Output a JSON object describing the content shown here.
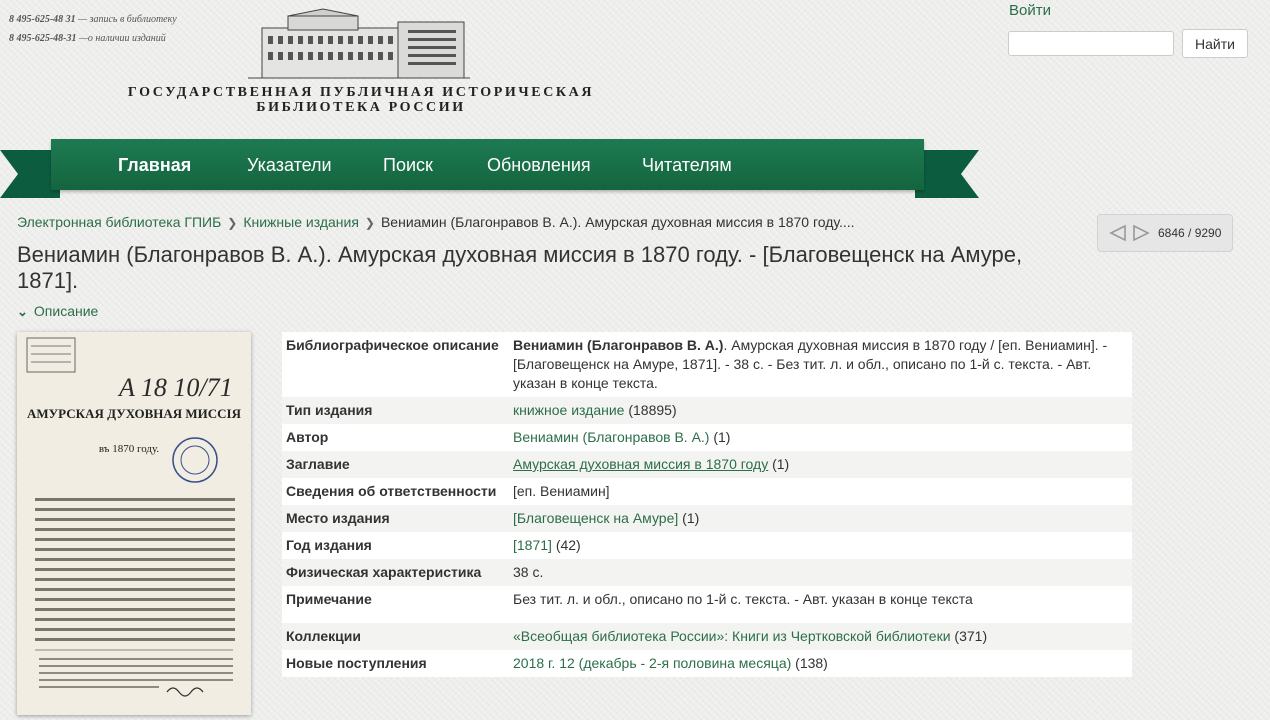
{
  "header": {
    "phones": [
      {
        "number": "8 495-625-48 31",
        "note": " — запись в библиотеку"
      },
      {
        "number": "8 495-625-48-31",
        "note": " —о наличии изданий"
      }
    ],
    "library_name": "ГОСУДАРСТВЕННАЯ ПУБЛИЧНАЯ ИСТОРИЧЕСКАЯ БИБЛИОТЕКА РОССИИ",
    "login": "Войти",
    "search_value": "",
    "search_button": "Найти"
  },
  "nav": [
    {
      "label": "Главная",
      "active": true
    },
    {
      "label": "Указатели"
    },
    {
      "label": "Поиск"
    },
    {
      "label": "Обновления"
    },
    {
      "label": "Читателям"
    }
  ],
  "breadcrumb": [
    {
      "label": "Электронная библиотека ГПИБ"
    },
    {
      "label": "Книжные издания"
    },
    {
      "label": "Вениамин (Благонравов В. А.). Амурская духовная миссия в 1870 году...."
    }
  ],
  "pager": {
    "count": "6846 / 9290"
  },
  "title": "Вениамин (Благонравов В. А.). Амурская духовная миссия в 1870 году. - [Благовещенск на Амуре, 1871].",
  "description_toggle": "Описание",
  "record": {
    "biblio_label": "Библиографическое описание",
    "biblio_bold": "Вениамин (Благонравов В. А.)",
    "biblio_rest": ". Амурская духовная миссия в 1870 году / [еп. Вениамин]. - [Благовещенск на Амуре, 1871]. - 38 с. - Без тит. л. и обл., описано по 1-й с. текста. - Авт. указан в конце текста.",
    "type_label": "Тип издания",
    "type_link": "книжное издание",
    "type_count": " (18895)",
    "author_label": "Автор",
    "author_link": "Вениамин (Благонравов В. А.)",
    "author_count": " (1)",
    "title_label": "Заглавие",
    "title_link": "Амурская духовная миссия в 1870 году",
    "title_count": " (1)",
    "resp_label": "Сведения об ответственности",
    "resp_value": "[еп. Вениамин]",
    "place_label": "Место издания",
    "place_link": "[Благовещенск на Амуре]",
    "place_count": " (1)",
    "year_label": "Год издания",
    "year_link": "[1871]",
    "year_count": " (42)",
    "phys_label": "Физическая характеристика",
    "phys_value": "38 с.",
    "note_label": "Примечание",
    "note_value": "Без тит. л. и обл., описано по 1-й с. текста. - Авт. указан в конце текста",
    "coll_label": "Коллекции",
    "coll_link": "«Всеобщая библиотека России»: Книги из Чертковской библиотеки",
    "coll_count": " (371)",
    "new_label": "Новые поступления",
    "new_link": "2018 г. 12 (декабрь - 2-я половина месяца)",
    "new_count": " (138)"
  },
  "cover": {
    "handwritten": "A 18 10/71",
    "title": "АМУРСКАЯ ДУХОВНАЯ МИССІЯ",
    "subtitle": "въ 1870 году."
  },
  "colors": {
    "brand_green": "#1d7a52",
    "link_green": "#2c6e49"
  }
}
